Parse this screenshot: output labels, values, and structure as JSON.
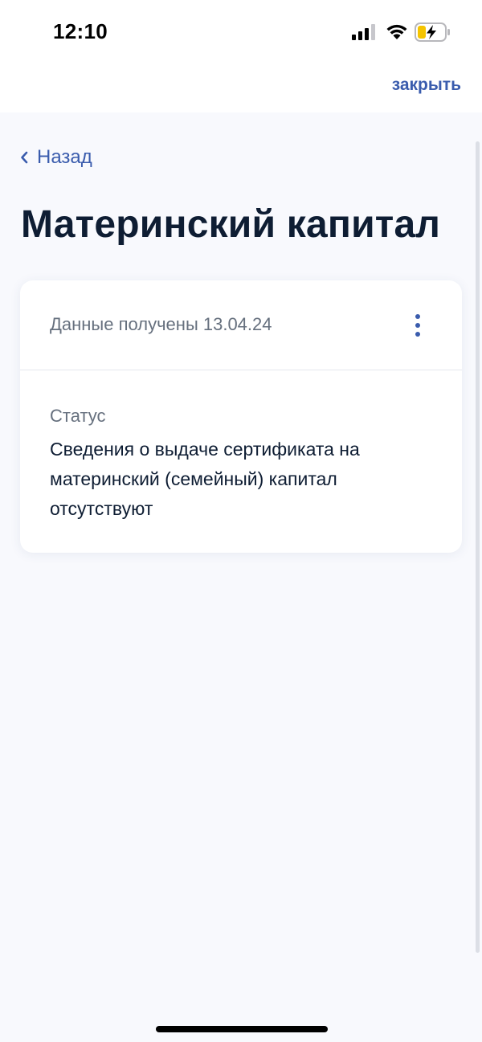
{
  "status_bar": {
    "time": "12:10",
    "icons": [
      "signal-icon",
      "wifi-icon",
      "battery-charging-icon"
    ]
  },
  "nav": {
    "close_label": "закрыть",
    "back_label": "Назад"
  },
  "page": {
    "title": "Материнский капитал"
  },
  "card": {
    "received_text": "Данные получены 13.04.24",
    "status_label": "Статус",
    "status_value": "Сведения о выдаче сертификата на материнский (семейный) капитал отсутствуют"
  },
  "colors": {
    "accent": "#3a5cad",
    "title": "#0e1d33",
    "muted": "#66707e",
    "background": "#f8f9fd",
    "battery_fill": "#f5c400"
  }
}
